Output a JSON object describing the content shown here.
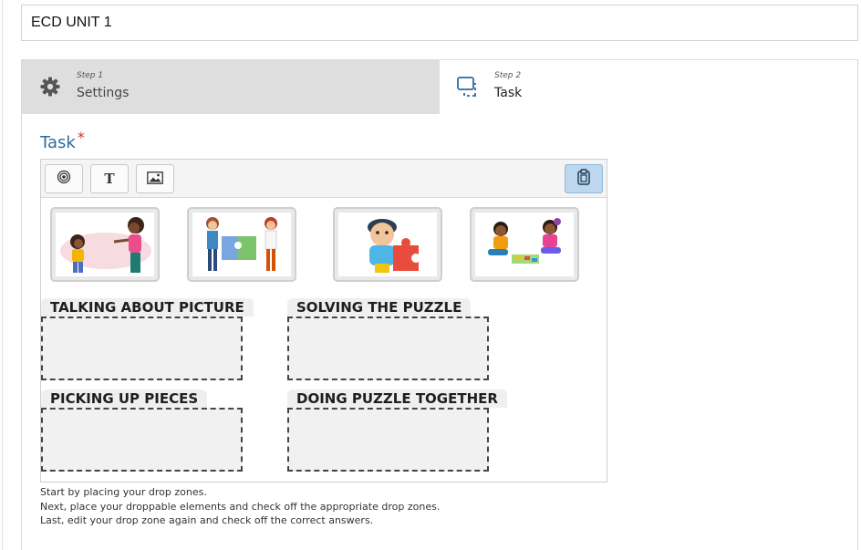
{
  "title_field": {
    "value": "ECD UNIT 1"
  },
  "wizard": {
    "steps": [
      {
        "kicker": "Step 1",
        "label": "Settings",
        "icon": "gear-icon"
      },
      {
        "kicker": "Step 2",
        "label": "Task",
        "icon": "drag-drop-icon"
      }
    ]
  },
  "task": {
    "heading": "Task",
    "required_mark": "*"
  },
  "toolbar": {
    "buttons": [
      {
        "icon": "drop-zone-icon"
      },
      {
        "icon": "text-icon",
        "glyph": "T"
      },
      {
        "icon": "image-icon"
      },
      {
        "icon": "paste-icon"
      }
    ]
  },
  "images": [
    {
      "icon": "teacher-child-talking-image"
    },
    {
      "icon": "children-holding-puzzle-image"
    },
    {
      "icon": "child-with-puzzle-piece-image"
    },
    {
      "icon": "children-playing-puzzle-image"
    }
  ],
  "drop_zones": [
    {
      "label": "TALKING ABOUT PICTURE"
    },
    {
      "label": "SOLVING THE PUZZLE"
    },
    {
      "label": "PICKING UP PIECES"
    },
    {
      "label": "DOING PUZZLE TOGETHER"
    }
  ],
  "instructions": [
    "Start by placing your drop zones.",
    "Next, place your droppable elements and check off the appropriate drop zones.",
    "Last, edit your drop zone again and check off the correct answers."
  ],
  "colors": {
    "heading": "#2e6aa1",
    "required": "#c0392b",
    "active_button": "#bdd7ee",
    "settings_tab_bg": "#dedede"
  }
}
